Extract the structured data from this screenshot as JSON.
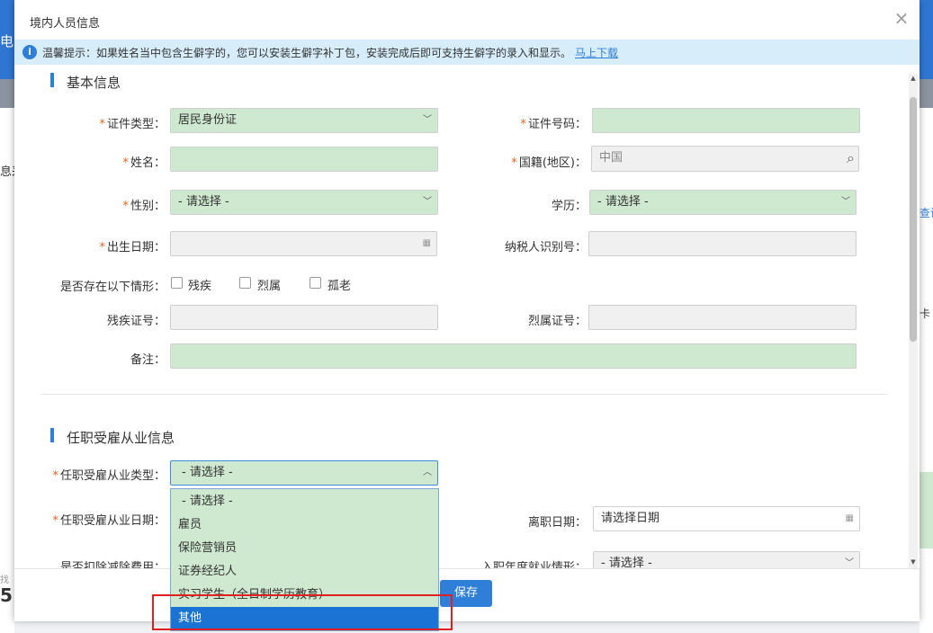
{
  "background": {
    "left_fragments": [
      "电",
      "息采"
    ],
    "right_fragments": [
      "查询",
      "卡"
    ],
    "bottom_left_fragments": [
      "找",
      "5"
    ]
  },
  "modal": {
    "title": "境内人员信息",
    "close_icon": "close-icon"
  },
  "notice": {
    "text": "温馨提示：如果姓名当中包含生僻字的，您可以安装生僻字补丁包，安装完成后即可支持生僻字的录入和显示。",
    "link": "马上下载"
  },
  "basic": {
    "title": "基本信息",
    "id_type": {
      "label": "证件类型：",
      "value": "居民身份证"
    },
    "id_number": {
      "label": "证件号码：",
      "value": ""
    },
    "name": {
      "label": "姓名：",
      "value": ""
    },
    "nationality": {
      "label": "国籍(地区)：",
      "value": "中国"
    },
    "gender": {
      "label": "性别：",
      "value": "- 请选择 -"
    },
    "education": {
      "label": "学历：",
      "value": "- 请选择 -"
    },
    "birth_date": {
      "label": "出生日期：",
      "value": ""
    },
    "tax_id": {
      "label": "纳税人识别号：",
      "value": ""
    },
    "situation": {
      "label": "是否存在以下情形：",
      "options": [
        "残疾",
        "烈属",
        "孤老"
      ]
    },
    "disability_cert": {
      "label": "残疾证号：",
      "value": ""
    },
    "martyr_cert": {
      "label": "烈属证号：",
      "value": ""
    },
    "remark": {
      "label": "备注：",
      "value": ""
    }
  },
  "employment": {
    "title": "任职受雇从业信息",
    "type": {
      "label": "任职受雇从业类型：",
      "value": "- 请选择 -"
    },
    "date": {
      "label": "任职受雇从业日期：",
      "value": ""
    },
    "leave_date": {
      "label": "离职日期：",
      "value": "请选择日期"
    },
    "deduction": {
      "label": "是否扣除减除费用："
    },
    "entry_year": {
      "label": "入职年度就业情形：",
      "value": "- 请选择 -"
    },
    "dropdown_options": [
      "- 请选择 -",
      "雇员",
      "保险营销员",
      "证券经纪人",
      "实习学生（全日制学历教育）",
      "其他"
    ],
    "selected_index": 5
  },
  "footer": {
    "save_label": "保存"
  }
}
